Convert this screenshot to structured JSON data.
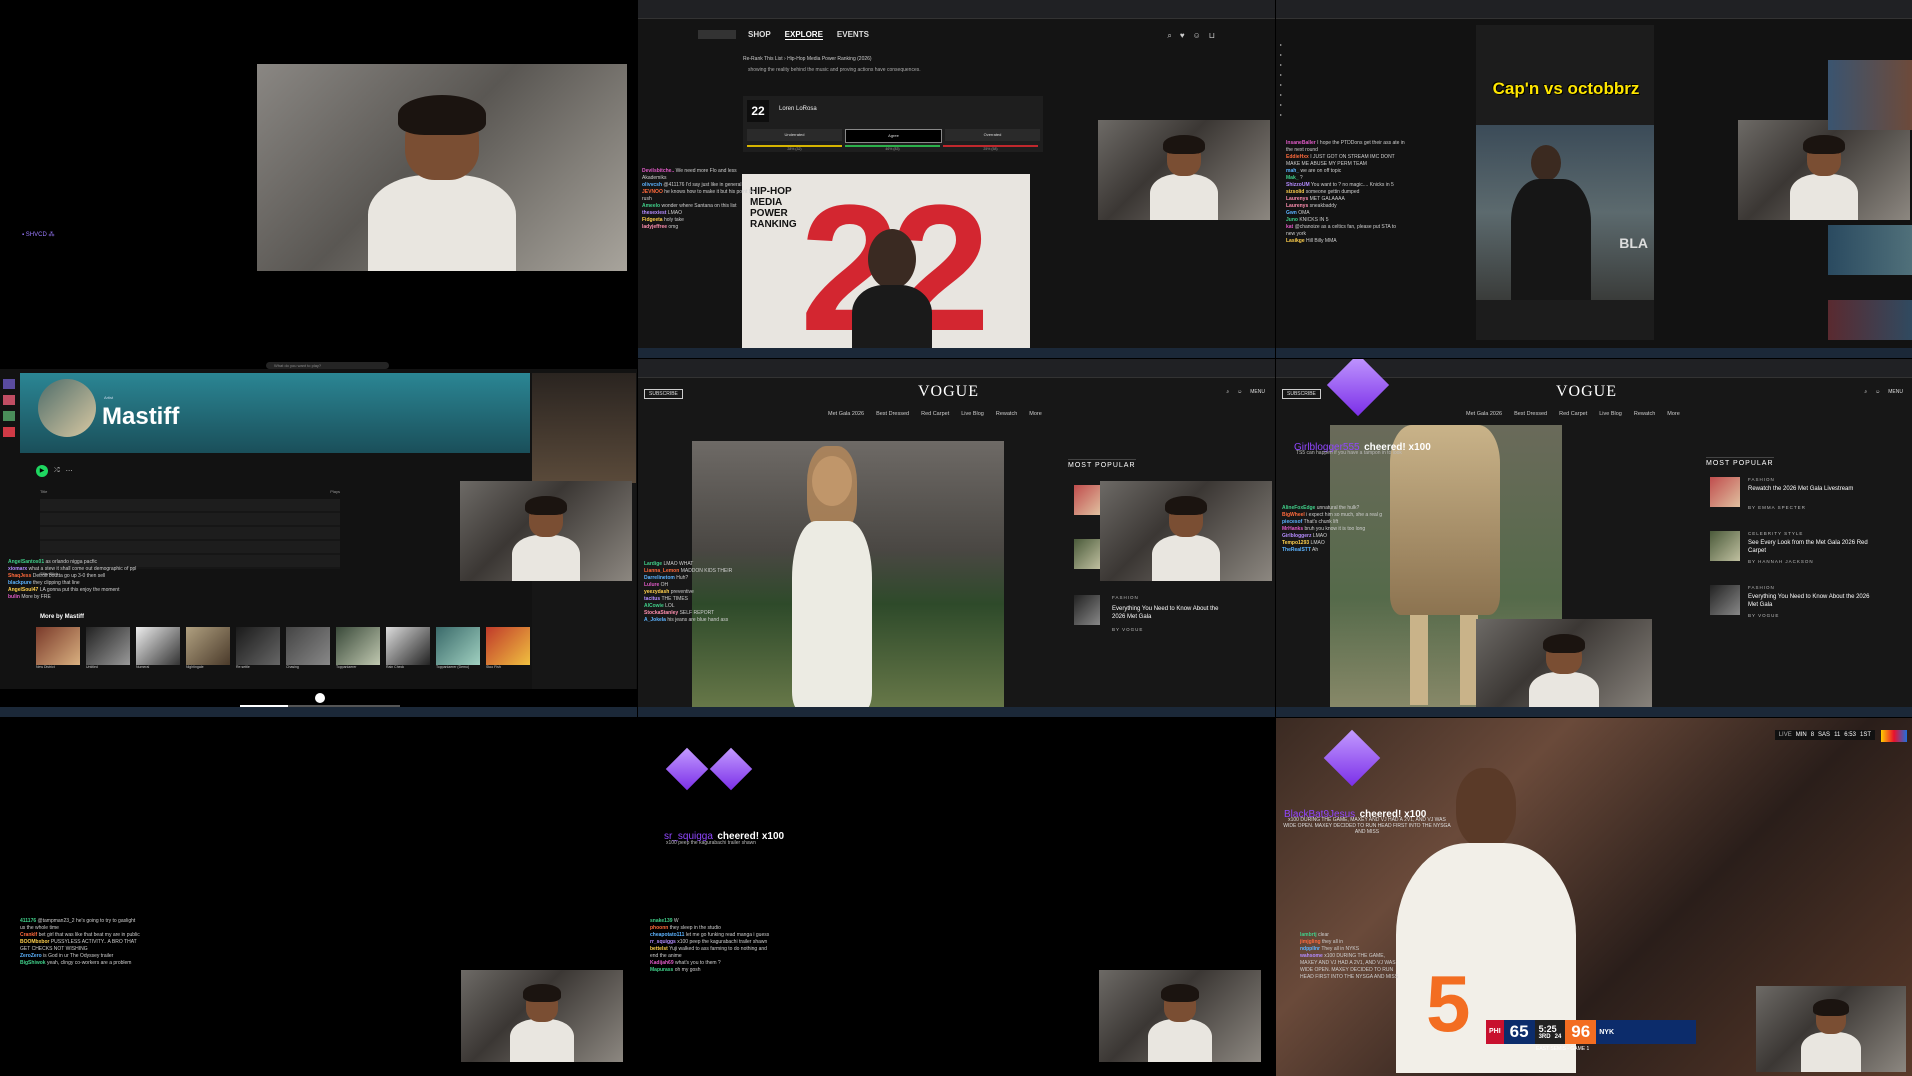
{
  "tile1": {
    "badge": "▪ SHVCD ⁂"
  },
  "tile2": {
    "nav": [
      "SHOP",
      "EXPLORE",
      "EVENTS"
    ],
    "breadcrumb": "Re-Rank This List  ›  Hip-Hop Media Power Ranking (2026)",
    "intro": "showing the reality behind the music and proving actions have consequences.",
    "rank": "22",
    "name": "Loren LoRosa",
    "votes": [
      "Underrated",
      "Agree",
      "Overrated"
    ],
    "vote_pcts": [
      "28% (32)",
      "46% (83)",
      "25% (58)"
    ],
    "poster_title": "HIP-HOP MEDIA POWER RANKING",
    "poster_number": "22",
    "chat": [
      {
        "u": "Devilsbitche..",
        "m": "We need more Flo and less Akademiks"
      },
      {
        "u": "olivvcsh",
        "m": "@411176 I'd say just like in general"
      },
      {
        "u": "JEVNOO",
        "m": "he knows how to make it but his point be rush"
      },
      {
        "u": "Ameelo",
        "m": "wonder where Santana on this list"
      },
      {
        "u": "thesexiest",
        "m": "LMAO"
      },
      {
        "u": "Fidgeeta",
        "m": "holy take"
      },
      {
        "u": "ladyjeffree",
        "m": "omg"
      }
    ]
  },
  "tile3": {
    "overlay_title": "Cap'n vs octobbrz",
    "shirt": "BLA",
    "chat": [
      {
        "u": "InsaneBaller",
        "m": "I hope the PTDDons get their ass ate in the next round"
      },
      {
        "u": "EddieHxx",
        "m": "I JUST GOT ON STREAM IMC DONT MAKE ME ABUSE MY PERM TEAM"
      },
      {
        "u": "mah_",
        "m": "we are on off topic"
      },
      {
        "u": "Mak_",
        "m": "?"
      },
      {
        "u": "ShizzoUM",
        "m": "You want to ? no magic.... Knicks in 5"
      },
      {
        "u": "sizsolid",
        "m": "someone gettin dumped"
      },
      {
        "u": "Laurenys",
        "m": "MET GALAAAA"
      },
      {
        "u": "Laurenys",
        "m": "sneakbaddy"
      },
      {
        "u": "Gwn",
        "m": "OMA"
      },
      {
        "u": "Juno",
        "m": "KNICKS IN 5"
      },
      {
        "u": "kat",
        "m": "@chanoize as a celtics fan, please put STA to new york"
      },
      {
        "u": "Lasikge",
        "m": "Hill Billy MMA"
      }
    ]
  },
  "tile4": {
    "search_placeholder": "What do you want to play?",
    "artist": "Mastiff",
    "subtitle": "Artist",
    "tracks_header": "Title",
    "plays_header": "Plays",
    "cheer_line": "Silky Blick",
    "about_title": "More by Mastiff",
    "albums": [
      "New District",
      "Untitled",
      "Numeral",
      "Nightingale",
      "Re:settle",
      "Chasing",
      "Toppanlaerer",
      "Rain Check",
      "Toppanlaerer (Demo)",
      "Stoo Fish"
    ],
    "chat": [
      {
        "u": "AngelSantos01",
        "m": "as orlando nigga pacfic"
      },
      {
        "u": "xiomarx",
        "m": "what a stew it shall come out demographic of ppl"
      },
      {
        "u": "ShaqJess",
        "m": "Detroit boutta go up 3-0 then sell"
      },
      {
        "u": "blackpure",
        "m": "they clipping that line"
      },
      {
        "u": "AngelSoul47",
        "m": "LA gonna put this enjoy the moment"
      },
      {
        "u": "bulin",
        "m": "More by FRE"
      }
    ]
  },
  "tile5": {
    "subscribe": "SUBSCRIBE",
    "logo": "VOGUE",
    "menu": "MENU",
    "nav": [
      "Met Gala 2026",
      "Best Dressed",
      "Red Carpet",
      "Live Blog",
      "Rewatch",
      "More"
    ],
    "most_popular": "MOST POPULAR",
    "article_category": "FASHION",
    "article_title": "Everything You Need to Know About the 2026 Met Gala",
    "article_by": "BY VOGUE",
    "chat": [
      {
        "u": "Lardige",
        "m": "LMAO WHAT"
      },
      {
        "u": "Lianna_Lemon",
        "m": "MADDON KIDS THEIR"
      },
      {
        "u": "Darrelinetom",
        "m": "Huh?"
      },
      {
        "u": "Lulure",
        "m": "OH"
      },
      {
        "u": "yeezydash",
        "m": "preventive"
      },
      {
        "u": "tacitus",
        "m": "THE TIMES"
      },
      {
        "u": "AlCowie",
        "m": "LOL"
      },
      {
        "u": "StockaStanley",
        "m": "SELF REPORT"
      },
      {
        "u": "A_Jokela",
        "m": "his jeans are blue hand ass"
      }
    ]
  },
  "tile6": {
    "subscribe": "SUBSCRIBE",
    "logo": "VOGUE",
    "menu": "MENU",
    "nav": [
      "Met Gala 2026",
      "Best Dressed",
      "Red Carpet",
      "Live Blog",
      "Rewatch",
      "More"
    ],
    "cheer_user": "Girlblogger555",
    "cheer_text": "cheered! x100",
    "cheer_msg": "TS5 can happen if you have a tampon in to look",
    "most_popular": "MOST POPULAR",
    "articles": [
      {
        "cat": "FASHION",
        "title": "Rewatch the 2026 Met Gala Livestream",
        "by": "BY EMMA SPECTER"
      },
      {
        "cat": "CELEBRITY STYLE",
        "title": "See Every Look from the Met Gala 2026 Red Carpet",
        "by": "BY HANNAH JACKSON"
      },
      {
        "cat": "FASHION",
        "title": "Everything You Need to Know About the 2026 Met Gala",
        "by": "BY VOGUE"
      }
    ],
    "chat": [
      {
        "u": "AlineFoxEdge",
        "m": "unnatural the hulk?"
      },
      {
        "u": "BigWheel",
        "m": "i expect him so much, she a real g"
      },
      {
        "u": "piecesof",
        "m": "That's chunk lift"
      },
      {
        "u": "MrHanks",
        "m": "bruh you know it is too long"
      },
      {
        "u": "Girlbloggerz",
        "m": "LMAO"
      },
      {
        "u": "Tempo1293",
        "m": "LMAO"
      },
      {
        "u": "TheRealSTT",
        "m": "Ah"
      }
    ]
  },
  "tile7": {
    "chat": [
      {
        "u": "411176",
        "m": "@tampman23_2 he's going to try to gaslight us the whole time"
      },
      {
        "u": "Cranklf",
        "m": "bet girl that was like that beat my are in public"
      },
      {
        "u": "BOOMbxbor",
        "m": "PUSSYLESS ACTIVITY.. A BRO THAT GET CHECKS NOT WISHING"
      },
      {
        "u": "ZeroZero",
        "m": "is God in ur The Odyssey trailer"
      },
      {
        "u": "BigShiwok",
        "m": "yeah, clingy co-workers are a problem"
      }
    ]
  },
  "tile8": {
    "cheer_user": "sr_squigga",
    "cheer_text": "cheered! x100",
    "cheer_msg": "x100 peep the kagurabachi trailer shawn",
    "chat": [
      {
        "u": "snake139",
        "m": "W"
      },
      {
        "u": "phoonn",
        "m": "they sleep in the studio"
      },
      {
        "u": "cheapotato111",
        "m": "let me go funking read manga i guess"
      },
      {
        "u": "rr_squiggs",
        "m": "x100 peep the kagurabachi trailer shawn"
      },
      {
        "u": "bettelst",
        "m": "Yuji walked to ass farming to do nothing and end the anime"
      },
      {
        "u": "Kadijah69",
        "m": "what's you to them ?"
      },
      {
        "u": "Mapurass",
        "m": "oh my gosh"
      }
    ]
  },
  "tile9": {
    "cheer_user": "BlackBat9Jesus",
    "cheer_text": "cheered! x100",
    "cheer_msg": "x100 DURING THE GAME, MAXEY AND VJ HAD A 2V1, AND VJ WAS WIDE OPEN. MAXEY DECIDED TO RUN HEAD FIRST INTO THE NYSGA AND MISS",
    "top_score": {
      "t1": "MIN",
      "s1": "8",
      "t2": "SAS",
      "s2": "11",
      "clock": "6:53",
      "period": "1ST",
      "tag": "LIVE"
    },
    "score": {
      "team1": "PHI",
      "score1": "65",
      "team2": "NYK",
      "score2": "96",
      "clock": "5:25",
      "quarter": "3RD",
      "shot": "24",
      "series": "EAST SEMIS - GAME 1"
    },
    "jersey": "5",
    "chat": [
      {
        "u": "lambrtj",
        "m": "clear"
      },
      {
        "u": "jimjgling",
        "m": "they all in"
      },
      {
        "u": "ndppllnr",
        "m": "They all in NYKS"
      },
      {
        "u": "wahsome",
        "m": "x100 DURING THE GAME, MAXEY AND VJ HAD A 2V1, AND VJ WAS WIDE OPEN. MAXEY DECIDED TO RUN HEAD FIRST INTO THE NYSGA AND MISS"
      }
    ]
  }
}
